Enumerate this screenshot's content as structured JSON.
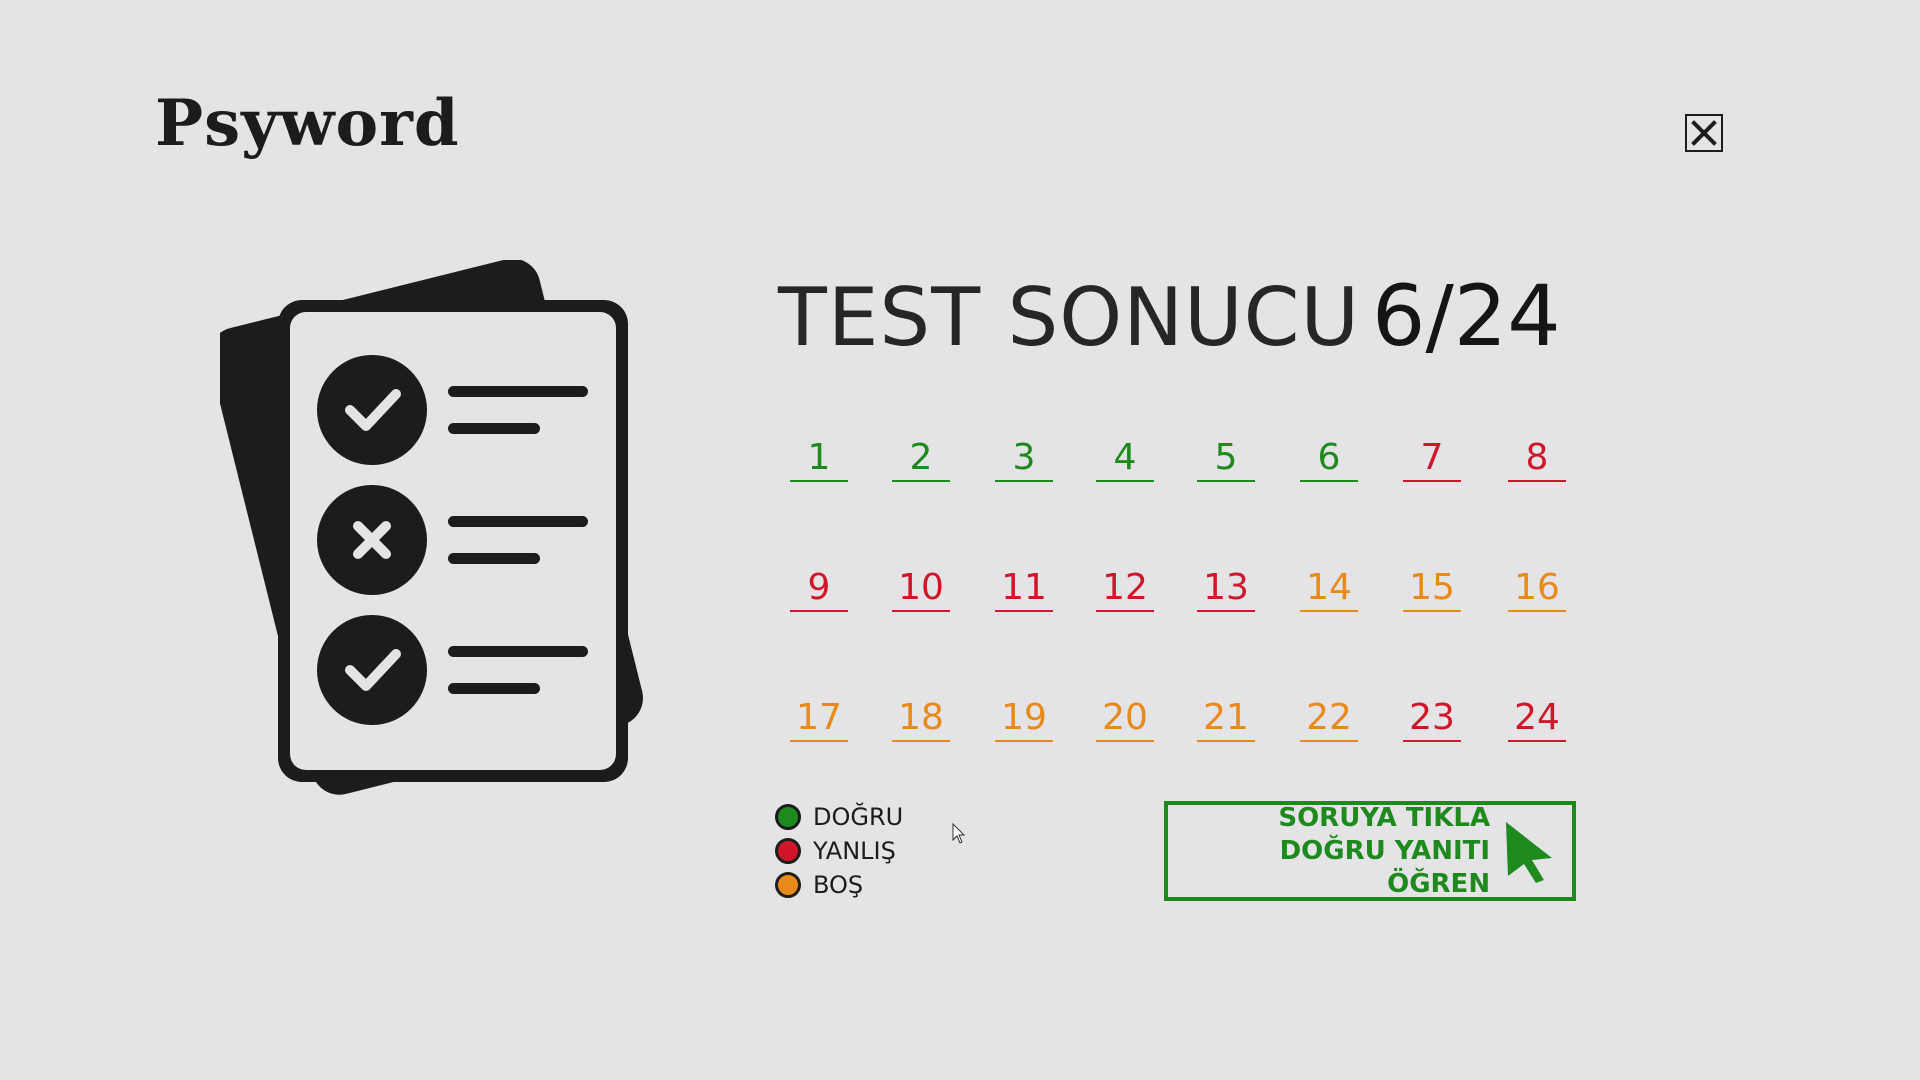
{
  "brand": {
    "logo_text": "Psyword"
  },
  "window": {
    "close_icon": "close-x-icon"
  },
  "result": {
    "title": "TEST SONUCU",
    "score": "6/24"
  },
  "colors": {
    "correct": "#1e8a1e",
    "wrong": "#d0172a",
    "empty": "#e88a1a",
    "background": "#e4e3e5"
  },
  "questions": [
    {
      "n": "1",
      "status": "correct"
    },
    {
      "n": "2",
      "status": "correct"
    },
    {
      "n": "3",
      "status": "correct"
    },
    {
      "n": "4",
      "status": "correct"
    },
    {
      "n": "5",
      "status": "correct"
    },
    {
      "n": "6",
      "status": "correct"
    },
    {
      "n": "7",
      "status": "wrong"
    },
    {
      "n": "8",
      "status": "wrong"
    },
    {
      "n": "9",
      "status": "wrong"
    },
    {
      "n": "10",
      "status": "wrong"
    },
    {
      "n": "11",
      "status": "wrong"
    },
    {
      "n": "12",
      "status": "wrong"
    },
    {
      "n": "13",
      "status": "wrong"
    },
    {
      "n": "14",
      "status": "empty"
    },
    {
      "n": "15",
      "status": "empty"
    },
    {
      "n": "16",
      "status": "empty"
    },
    {
      "n": "17",
      "status": "empty"
    },
    {
      "n": "18",
      "status": "empty"
    },
    {
      "n": "19",
      "status": "empty"
    },
    {
      "n": "20",
      "status": "empty"
    },
    {
      "n": "21",
      "status": "empty"
    },
    {
      "n": "22",
      "status": "empty"
    },
    {
      "n": "23",
      "status": "wrong"
    },
    {
      "n": "24",
      "status": "wrong"
    }
  ],
  "legend": {
    "correct": "DOĞRU",
    "wrong": "YANLIŞ",
    "empty": "BOŞ"
  },
  "cta": {
    "line1": "SORUYA TIKLA",
    "line2": "DOĞRU YANITI ÖĞREN",
    "icon": "arrow-cursor-icon"
  }
}
